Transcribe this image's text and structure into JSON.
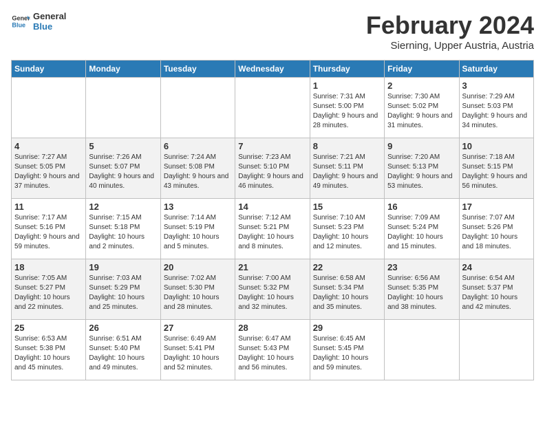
{
  "header": {
    "logo_line1": "General",
    "logo_line2": "Blue",
    "title": "February 2024",
    "subtitle": "Sierning, Upper Austria, Austria"
  },
  "days_of_week": [
    "Sunday",
    "Monday",
    "Tuesday",
    "Wednesday",
    "Thursday",
    "Friday",
    "Saturday"
  ],
  "weeks": [
    [
      {
        "day": "",
        "empty": true
      },
      {
        "day": "",
        "empty": true
      },
      {
        "day": "",
        "empty": true
      },
      {
        "day": "",
        "empty": true
      },
      {
        "day": "1",
        "sunrise": "7:31 AM",
        "sunset": "5:00 PM",
        "daylight": "9 hours and 28 minutes."
      },
      {
        "day": "2",
        "sunrise": "7:30 AM",
        "sunset": "5:02 PM",
        "daylight": "9 hours and 31 minutes."
      },
      {
        "day": "3",
        "sunrise": "7:29 AM",
        "sunset": "5:03 PM",
        "daylight": "9 hours and 34 minutes."
      }
    ],
    [
      {
        "day": "4",
        "sunrise": "7:27 AM",
        "sunset": "5:05 PM",
        "daylight": "9 hours and 37 minutes."
      },
      {
        "day": "5",
        "sunrise": "7:26 AM",
        "sunset": "5:07 PM",
        "daylight": "9 hours and 40 minutes."
      },
      {
        "day": "6",
        "sunrise": "7:24 AM",
        "sunset": "5:08 PM",
        "daylight": "9 hours and 43 minutes."
      },
      {
        "day": "7",
        "sunrise": "7:23 AM",
        "sunset": "5:10 PM",
        "daylight": "9 hours and 46 minutes."
      },
      {
        "day": "8",
        "sunrise": "7:21 AM",
        "sunset": "5:11 PM",
        "daylight": "9 hours and 49 minutes."
      },
      {
        "day": "9",
        "sunrise": "7:20 AM",
        "sunset": "5:13 PM",
        "daylight": "9 hours and 53 minutes."
      },
      {
        "day": "10",
        "sunrise": "7:18 AM",
        "sunset": "5:15 PM",
        "daylight": "9 hours and 56 minutes."
      }
    ],
    [
      {
        "day": "11",
        "sunrise": "7:17 AM",
        "sunset": "5:16 PM",
        "daylight": "9 hours and 59 minutes."
      },
      {
        "day": "12",
        "sunrise": "7:15 AM",
        "sunset": "5:18 PM",
        "daylight": "10 hours and 2 minutes."
      },
      {
        "day": "13",
        "sunrise": "7:14 AM",
        "sunset": "5:19 PM",
        "daylight": "10 hours and 5 minutes."
      },
      {
        "day": "14",
        "sunrise": "7:12 AM",
        "sunset": "5:21 PM",
        "daylight": "10 hours and 8 minutes."
      },
      {
        "day": "15",
        "sunrise": "7:10 AM",
        "sunset": "5:23 PM",
        "daylight": "10 hours and 12 minutes."
      },
      {
        "day": "16",
        "sunrise": "7:09 AM",
        "sunset": "5:24 PM",
        "daylight": "10 hours and 15 minutes."
      },
      {
        "day": "17",
        "sunrise": "7:07 AM",
        "sunset": "5:26 PM",
        "daylight": "10 hours and 18 minutes."
      }
    ],
    [
      {
        "day": "18",
        "sunrise": "7:05 AM",
        "sunset": "5:27 PM",
        "daylight": "10 hours and 22 minutes."
      },
      {
        "day": "19",
        "sunrise": "7:03 AM",
        "sunset": "5:29 PM",
        "daylight": "10 hours and 25 minutes."
      },
      {
        "day": "20",
        "sunrise": "7:02 AM",
        "sunset": "5:30 PM",
        "daylight": "10 hours and 28 minutes."
      },
      {
        "day": "21",
        "sunrise": "7:00 AM",
        "sunset": "5:32 PM",
        "daylight": "10 hours and 32 minutes."
      },
      {
        "day": "22",
        "sunrise": "6:58 AM",
        "sunset": "5:34 PM",
        "daylight": "10 hours and 35 minutes."
      },
      {
        "day": "23",
        "sunrise": "6:56 AM",
        "sunset": "5:35 PM",
        "daylight": "10 hours and 38 minutes."
      },
      {
        "day": "24",
        "sunrise": "6:54 AM",
        "sunset": "5:37 PM",
        "daylight": "10 hours and 42 minutes."
      }
    ],
    [
      {
        "day": "25",
        "sunrise": "6:53 AM",
        "sunset": "5:38 PM",
        "daylight": "10 hours and 45 minutes."
      },
      {
        "day": "26",
        "sunrise": "6:51 AM",
        "sunset": "5:40 PM",
        "daylight": "10 hours and 49 minutes."
      },
      {
        "day": "27",
        "sunrise": "6:49 AM",
        "sunset": "5:41 PM",
        "daylight": "10 hours and 52 minutes."
      },
      {
        "day": "28",
        "sunrise": "6:47 AM",
        "sunset": "5:43 PM",
        "daylight": "10 hours and 56 minutes."
      },
      {
        "day": "29",
        "sunrise": "6:45 AM",
        "sunset": "5:45 PM",
        "daylight": "10 hours and 59 minutes."
      },
      {
        "day": "",
        "empty": true
      },
      {
        "day": "",
        "empty": true
      }
    ]
  ],
  "labels": {
    "sunrise": "Sunrise:",
    "sunset": "Sunset:",
    "daylight": "Daylight:"
  }
}
